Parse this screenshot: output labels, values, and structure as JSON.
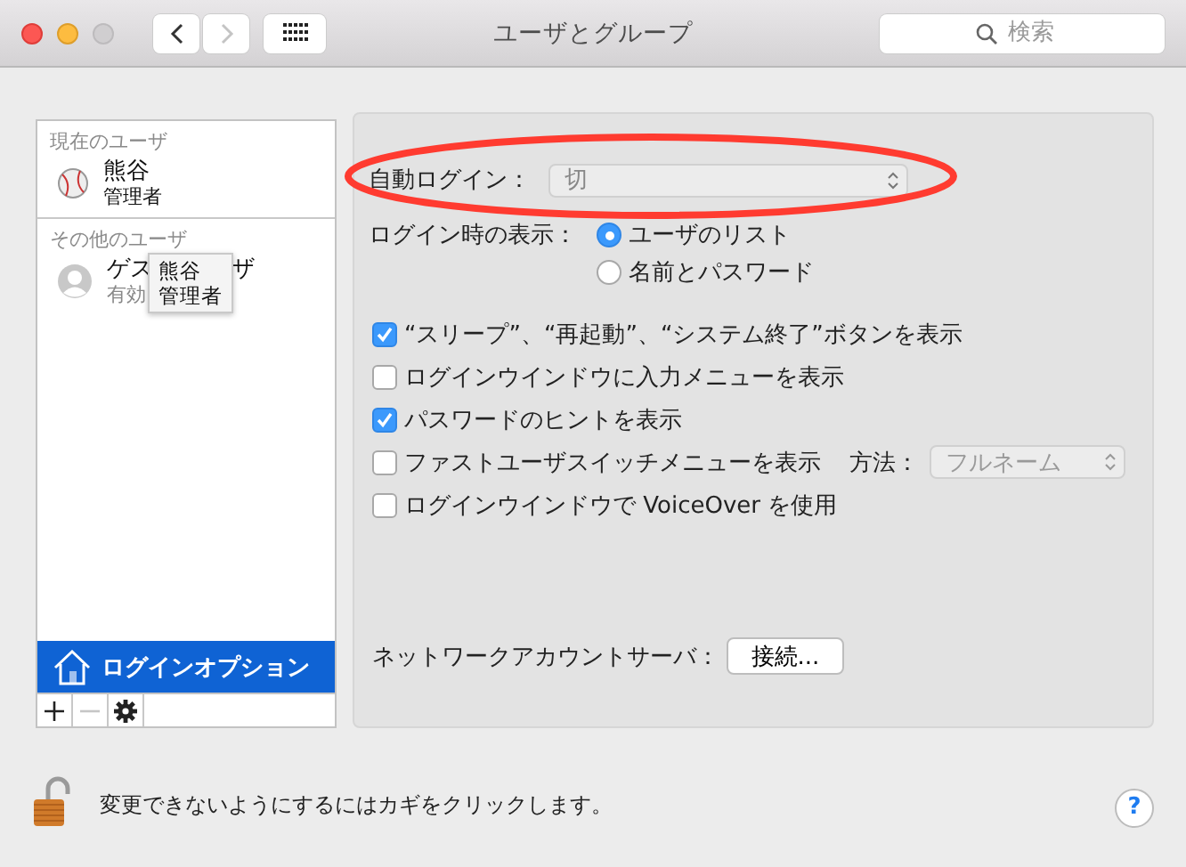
{
  "window": {
    "title": "ユーザとグループ",
    "search": {
      "placeholder": "検索"
    },
    "controls": [
      {
        "kind": "close",
        "disabled": false
      },
      {
        "kind": "minimize",
        "disabled": false
      },
      {
        "kind": "zoom",
        "disabled": true
      }
    ],
    "nav": [
      {
        "kind": "back",
        "disabled": false
      },
      {
        "kind": "forward",
        "disabled": true
      }
    ]
  },
  "sidebar": {
    "sections": [
      {
        "heading": "現在のユーザ",
        "users": [
          {
            "kind": "ball",
            "name_parts": [
              "熊谷"
            ],
            "role": "管理者"
          }
        ]
      },
      {
        "heading": "その他のユーザ",
        "users": [
          {
            "kind": "silhouette",
            "name_parts": [
              "ゲス",
              "ザ"
            ],
            "role": "有効"
          }
        ]
      }
    ],
    "tooltip": {
      "lines": [
        "熊谷",
        "管理者"
      ]
    },
    "items": [
      {
        "label": "ログインオプション",
        "selected": true
      }
    ],
    "toolbar": [
      {
        "kind": "add",
        "disabled": false
      },
      {
        "kind": "remove",
        "disabled": true
      },
      {
        "kind": "gear",
        "disabled": false
      }
    ]
  },
  "options": {
    "auto_login": {
      "label": "自動ログイン：",
      "value": "切"
    },
    "annotation": {
      "kind": "ellipse",
      "color": "#ff3b30"
    },
    "login_display": {
      "label": "ログイン時の表示：",
      "options": [
        {
          "label": "ユーザのリスト",
          "selected": true
        },
        {
          "label": "名前とパスワード",
          "selected": false
        }
      ]
    },
    "checkboxes": [
      {
        "label": "“スリープ”、“再起動”、“システム終了”ボタンを表示",
        "checked": true
      },
      {
        "label": "ログインウインドウに入力メニューを表示",
        "checked": false
      },
      {
        "label": "パスワードのヒントを表示",
        "checked": true
      },
      {
        "label": "ファストユーザスイッチメニューを表示",
        "checked": false,
        "method": {
          "label": "方法：",
          "value": "フルネーム",
          "disabled": true
        }
      },
      {
        "label": "ログインウインドウで VoiceOver を使用",
        "checked": false
      }
    ],
    "network": {
      "label": "ネットワークアカウントサーバ：",
      "button": "接続..."
    }
  },
  "footer": {
    "text": "変更できないようにするにはカギをクリックします。",
    "locked": false,
    "help": "?"
  }
}
